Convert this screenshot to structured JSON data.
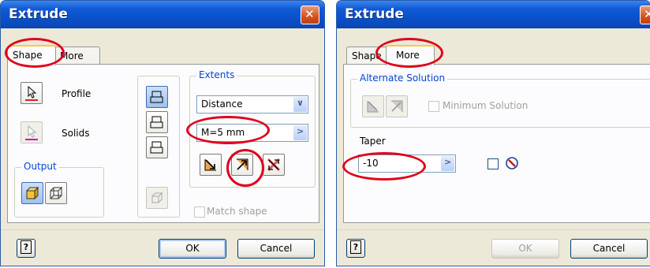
{
  "left": {
    "title": "Extrude",
    "tabs": [
      {
        "label": "Shape",
        "active": true
      },
      {
        "label": "More",
        "active": false
      }
    ],
    "profile_label": "Profile",
    "solids_label": "Solids",
    "output_label": "Output",
    "extents_label": "Extents",
    "extents_type": "Distance",
    "distance_value": "M=5 mm",
    "match_shape_label": "Match shape",
    "ok_label": "OK",
    "cancel_label": "Cancel"
  },
  "right": {
    "title": "Extrude",
    "tabs": [
      {
        "label": "Shape",
        "active": false
      },
      {
        "label": "More",
        "active": true
      }
    ],
    "alt_solution_label": "Alternate Solution",
    "min_solution_label": "Minimum Solution",
    "taper_label": "Taper",
    "taper_value": "-10",
    "ok_label": "OK",
    "cancel_label": "Cancel"
  },
  "icons": {
    "dropdown": "∨",
    "arrow_right": ">",
    "help": "?"
  },
  "colors": {
    "titlebar": "#0a4fc7",
    "highlight": "#e0001a",
    "accent": "#0046d5"
  }
}
